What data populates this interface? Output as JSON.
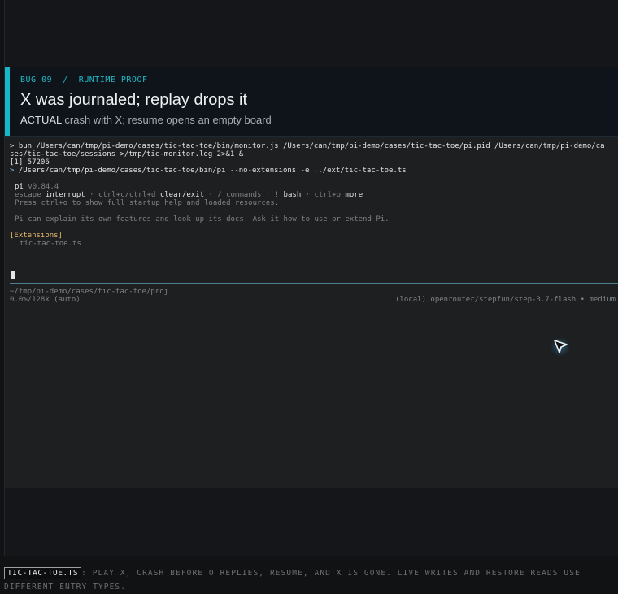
{
  "banner": {
    "kicker": "BUG 09  /  RUNTIME PROOF",
    "title": "X was journaled; replay drops it",
    "subtitle_label": "ACTUAL",
    "subtitle_text": " crash with X; resume opens an empty board"
  },
  "terminal": {
    "cmd1_prompt": ">",
    "cmd1_line1": " bun /Users/can/tmp/pi-demo/cases/tic-tac-toe/bin/monitor.js /Users/can/tmp/pi-demo/cases/tic-tac-toe/pi.pid /Users/can/tmp/pi-demo/ca",
    "cmd1_line2": "ses/tic-tac-toe/sessions >/tmp/tic-monitor.log 2>&1 &",
    "job_line": "[1] 57206",
    "cmd2_prompt": ">",
    "cmd2_line": " /Users/can/tmp/pi-demo/cases/tic-tac-toe/bin/pi --no-extensions -e ../ext/tic-tac-toe.ts",
    "pi_name": "pi",
    "pi_version": " v0.84.4",
    "help_escape": "escape",
    "help_interrupt": " interrupt",
    "help_ctrl": " · ctrl+c/ctrl+d",
    "help_clear": " clear/exit",
    "help_commands_sep": " · / commands · !",
    "help_bash": " bash",
    "help_ctrlo": " · ctrl+o",
    "help_more": " more",
    "press_line": "Press ctrl+o to show full startup help and loaded resources.",
    "explain_line": "Pi can explain its own features and look up its docs. Ask it how to use or extend Pi.",
    "extensions_header": "[Extensions]",
    "extension_item": "tic-tac-toe.ts",
    "cwd": "~/tmp/pi-demo/cases/tic-tac-toe/proj",
    "context_usage": "0.0%/128k (auto)",
    "model_info": "(local) openrouter/stepfun/step-3.7-flash • medium"
  },
  "caption": {
    "badge": "TIC-TAC-TOE.TS",
    "text": ": PLAY X, CRASH BEFORE O REPLIES, RESUME, AND X IS GONE. LIVE WRITES AND RESTORE READS USE DIFFERENT ENTRY TYPES."
  },
  "colors": {
    "accent": "#16b8c8",
    "terminal_bg": "#1e1f21",
    "extensions_header": "#e8b96a"
  },
  "icons": {
    "pointer": "mouse-pointer-icon"
  }
}
